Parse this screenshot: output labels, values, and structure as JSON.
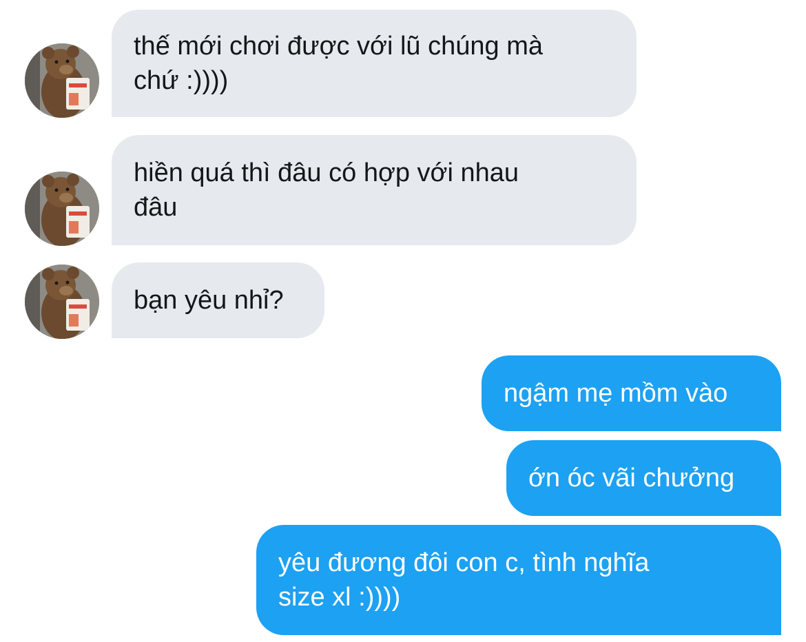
{
  "conversation": {
    "incoming": [
      {
        "text": "thế mới chơi được với lũ chúng mà\nchứ :))))",
        "avatar_icon": "teddy-bear-avatar-icon"
      },
      {
        "text": "hiền quá thì đâu có hợp với nhau\nđâu",
        "avatar_icon": "teddy-bear-avatar-icon"
      },
      {
        "text": "bạn yêu nhỉ?",
        "avatar_icon": "teddy-bear-avatar-icon"
      }
    ],
    "outgoing": [
      {
        "text": "ngậm mẹ mồm vào"
      },
      {
        "text": "ớn óc vãi chưởng"
      },
      {
        "text": "yêu đương đôi con c, tình nghĩa\nsize xl :))))"
      }
    ]
  },
  "colors": {
    "incoming_bubble": "#e6eaee",
    "incoming_text": "#14171a",
    "outgoing_bubble": "#1da1f2",
    "outgoing_text": "#ffffff"
  }
}
